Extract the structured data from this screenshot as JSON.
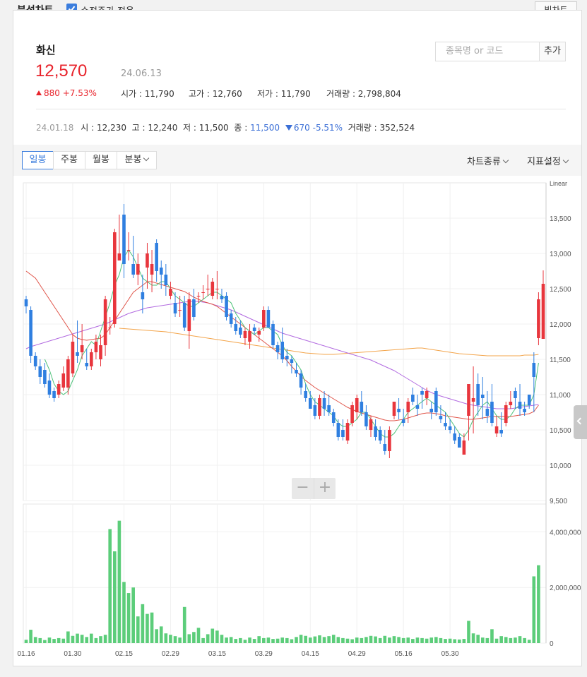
{
  "header": {
    "title": "분석차트",
    "adjusted_label": "수정주가 적용",
    "adjusted_checked": true,
    "big_chart_label": "빅차트"
  },
  "stock": {
    "name": "화신",
    "price": "12,570",
    "date": "24.06.13",
    "change": "880 +7.53%",
    "open_label": "시가",
    "open": "11,790",
    "high_label": "고가",
    "high": "12,760",
    "low_label": "저가",
    "low": "11,790",
    "volume_label": "거래량",
    "volume": "2,798,804"
  },
  "search": {
    "placeholder": "종목명 or 코드",
    "add_label": "추가"
  },
  "hover": {
    "date": "24.01.18",
    "open_label": "시",
    "open": "12,230",
    "high_label": "고",
    "high": "12,240",
    "low_label": "저",
    "low": "11,500",
    "close_label": "종",
    "close": "11,500",
    "change": "670 -5.51%",
    "volume_label": "거래량",
    "volume": "352,524"
  },
  "toolbar": {
    "tabs": [
      "일봉",
      "주봉",
      "월봉",
      "분봉"
    ],
    "active_tab": "일봉",
    "chart_type_label": "차트종류",
    "indicator_label": "지표설정"
  },
  "colors": {
    "up": "#e8363d",
    "down": "#2f7fe0",
    "volume": "#5ccd7a",
    "ma5": "#4ec27a",
    "ma20": "#e0554a",
    "ma60": "#b26be0",
    "ma120": "#f3a44a"
  },
  "chart_data": {
    "type": "candlestick",
    "scale_label": "Linear",
    "price_ticks": [
      "13,500",
      "13,000",
      "12,500",
      "12,000",
      "11,500",
      "11,000",
      "10,500",
      "10,000",
      "9,500"
    ],
    "price_tick_values": [
      13500,
      13000,
      12500,
      12000,
      11500,
      11000,
      10500,
      10000,
      9500
    ],
    "price_range": [
      9500,
      14000
    ],
    "volume_ticks": [
      "4,000,000",
      "2,000,000",
      "0"
    ],
    "volume_tick_values": [
      4000000,
      2000000,
      0
    ],
    "volume_range": [
      0,
      5000000
    ],
    "date_labels": [
      "01.16",
      "01.30",
      "02.15",
      "02.29",
      "03.15",
      "03.29",
      "04.15",
      "04.29",
      "05.16",
      "05.30"
    ],
    "date_label_index": [
      0,
      10,
      21,
      31,
      41,
      51,
      61,
      71,
      81,
      91
    ],
    "candles": [
      [
        12350,
        12400,
        12150,
        12250
      ],
      [
        12200,
        12250,
        11450,
        11550
      ],
      [
        11550,
        11600,
        11350,
        11400
      ],
      [
        11400,
        11500,
        11150,
        11250
      ],
      [
        11350,
        11450,
        11100,
        11150
      ],
      [
        11200,
        11300,
        10950,
        11000
      ],
      [
        11050,
        11100,
        10900,
        10950
      ],
      [
        11000,
        11200,
        10950,
        11150
      ],
      [
        11100,
        11400,
        11050,
        11300
      ],
      [
        11100,
        11550,
        11000,
        11500
      ],
      [
        11300,
        11850,
        11250,
        11750
      ],
      [
        11600,
        12050,
        11450,
        11550
      ],
      [
        11600,
        12000,
        11500,
        11700
      ],
      [
        11450,
        11650,
        11350,
        11400
      ],
      [
        11400,
        11650,
        11350,
        11600
      ],
      [
        11600,
        11850,
        11500,
        11750
      ],
      [
        11500,
        11850,
        11400,
        11700
      ],
      [
        11700,
        12400,
        11550,
        12350
      ],
      [
        11950,
        12100,
        11850,
        11950
      ],
      [
        12000,
        13350,
        11950,
        13300
      ],
      [
        12900,
        13550,
        12900,
        13000
      ],
      [
        13550,
        13700,
        12650,
        12850
      ],
      [
        13050,
        13300,
        12900,
        13050
      ],
      [
        12850,
        13250,
        12650,
        12700
      ],
      [
        12700,
        13000,
        12550,
        12850
      ],
      [
        12450,
        12700,
        12150,
        12350
      ],
      [
        12800,
        13150,
        12500,
        13000
      ],
      [
        12700,
        13050,
        12450,
        12850
      ],
      [
        13150,
        13200,
        12600,
        12750
      ],
      [
        12800,
        12900,
        12500,
        12700
      ],
      [
        12700,
        12850,
        12400,
        12550
      ],
      [
        12400,
        12600,
        12350,
        12500
      ],
      [
        12300,
        12450,
        12100,
        12150
      ],
      [
        12200,
        12400,
        12100,
        12200
      ],
      [
        12300,
        12400,
        11900,
        11950
      ],
      [
        11900,
        12450,
        11650,
        12350
      ],
      [
        12350,
        12500,
        12050,
        12100
      ],
      [
        12400,
        12450,
        12300,
        12400
      ],
      [
        12450,
        12550,
        12350,
        12450
      ],
      [
        12500,
        12700,
        12400,
        12500
      ],
      [
        12400,
        12650,
        12350,
        12600
      ],
      [
        12500,
        12750,
        12350,
        12500
      ],
      [
        12400,
        12500,
        12300,
        12350
      ],
      [
        12400,
        12450,
        12050,
        12100
      ],
      [
        12150,
        12200,
        11950,
        12000
      ],
      [
        12000,
        12100,
        11850,
        11900
      ],
      [
        11950,
        12050,
        11800,
        11850
      ],
      [
        11800,
        11950,
        11700,
        11900
      ],
      [
        11750,
        12000,
        11650,
        11900
      ],
      [
        11950,
        12000,
        11850,
        11900
      ],
      [
        11850,
        11950,
        11750,
        11900
      ],
      [
        11950,
        12250,
        11900,
        12200
      ],
      [
        12200,
        12250,
        11950,
        11950
      ],
      [
        12000,
        12050,
        11650,
        11700
      ],
      [
        11700,
        11750,
        11500,
        11600
      ],
      [
        11750,
        11950,
        11450,
        11500
      ],
      [
        11550,
        11650,
        11400,
        11500
      ],
      [
        11500,
        11550,
        11300,
        11450
      ],
      [
        11350,
        11450,
        11250,
        11300
      ],
      [
        11300,
        11350,
        11000,
        11100
      ],
      [
        11050,
        11150,
        10900,
        10950
      ],
      [
        10950,
        11050,
        10800,
        10800
      ],
      [
        10850,
        10950,
        10650,
        10700
      ],
      [
        10700,
        11000,
        10650,
        10950
      ],
      [
        10950,
        11050,
        10700,
        10800
      ],
      [
        10850,
        11000,
        10700,
        10750
      ],
      [
        10750,
        10800,
        10550,
        10600
      ],
      [
        10600,
        10650,
        10350,
        10400
      ],
      [
        10500,
        10650,
        10350,
        10400
      ],
      [
        10350,
        10650,
        10300,
        10600
      ],
      [
        10600,
        10900,
        10550,
        10850
      ],
      [
        10750,
        11000,
        10650,
        10950
      ],
      [
        10900,
        11050,
        10700,
        10750
      ],
      [
        10750,
        10850,
        10500,
        10550
      ],
      [
        10500,
        10700,
        10400,
        10650
      ],
      [
        10550,
        10650,
        10350,
        10400
      ],
      [
        10500,
        10550,
        10300,
        10350
      ],
      [
        10300,
        10500,
        10150,
        10200
      ],
      [
        10200,
        10550,
        10100,
        10500
      ],
      [
        10700,
        10900,
        10650,
        10900
      ],
      [
        10800,
        10950,
        10650,
        10750
      ],
      [
        10650,
        10800,
        10550,
        10600
      ],
      [
        10750,
        10950,
        10600,
        10900
      ],
      [
        11000,
        11100,
        10850,
        10900
      ],
      [
        10850,
        11000,
        10700,
        10800
      ],
      [
        11050,
        11100,
        10800,
        11000
      ],
      [
        10950,
        11100,
        10850,
        11050
      ],
      [
        10800,
        10900,
        10650,
        10750
      ],
      [
        11050,
        11100,
        10700,
        10750
      ],
      [
        10700,
        10850,
        10600,
        10650
      ],
      [
        10600,
        10750,
        10500,
        10550
      ],
      [
        10550,
        10650,
        10450,
        10500
      ],
      [
        10450,
        10550,
        10300,
        10350
      ],
      [
        10400,
        10450,
        10250,
        10250
      ],
      [
        10150,
        10450,
        10150,
        10350
      ],
      [
        10700,
        11150,
        10350,
        11150
      ],
      [
        10900,
        11400,
        10450,
        10950
      ],
      [
        11150,
        11300,
        10700,
        10850
      ],
      [
        11000,
        11250,
        10650,
        10950
      ],
      [
        10800,
        11050,
        10600,
        10700
      ],
      [
        10900,
        11150,
        10550,
        10600
      ],
      [
        10450,
        10700,
        10400,
        10550
      ],
      [
        10500,
        10750,
        10400,
        10450
      ],
      [
        10600,
        10900,
        10550,
        10850
      ],
      [
        10850,
        11050,
        10800,
        10900
      ],
      [
        11050,
        11100,
        10800,
        10950
      ],
      [
        10900,
        11150,
        10700,
        10800
      ],
      [
        10800,
        10900,
        10700,
        10750
      ],
      [
        11000,
        11000,
        10800,
        10850
      ],
      [
        11450,
        11600,
        10750,
        11250
      ],
      [
        11800,
        12450,
        11700,
        12350
      ],
      [
        11790,
        12760,
        11790,
        12570
      ]
    ],
    "volumes": [
      120000,
      480000,
      220000,
      180000,
      110000,
      200000,
      150000,
      180000,
      160000,
      420000,
      260000,
      340000,
      300000,
      220000,
      340000,
      180000,
      250000,
      300000,
      4100000,
      3300000,
      4400000,
      2200000,
      1800000,
      2000000,
      960000,
      1400000,
      1050000,
      1100000,
      500000,
      600000,
      350000,
      300000,
      250000,
      200000,
      1300000,
      320000,
      400000,
      550000,
      180000,
      320000,
      520000,
      450000,
      300000,
      200000,
      220000,
      150000,
      180000,
      120000,
      200000,
      150000,
      250000,
      180000,
      200000,
      150000,
      160000,
      200000,
      180000,
      140000,
      220000,
      300000,
      260000,
      200000,
      240000,
      280000,
      220000,
      250000,
      300000,
      220000,
      180000,
      160000,
      140000,
      200000,
      180000,
      220000,
      260000,
      240000,
      180000,
      260000,
      200000,
      250000,
      220000,
      180000,
      200000,
      150000,
      200000,
      180000,
      160000,
      200000,
      220000,
      180000,
      150000,
      160000,
      140000,
      130000,
      150000,
      800000,
      350000,
      300000,
      200000,
      180000,
      500000,
      160000,
      250000,
      220000,
      180000,
      200000,
      250000,
      180000,
      120000,
      2400000,
      2800000
    ],
    "ma5": [
      null,
      null,
      null,
      null,
      11500,
      11350,
      11150,
      11050,
      11000,
      11050,
      11200,
      11350,
      11550,
      11650,
      11750,
      11700,
      11900,
      12100,
      12300,
      12550,
      12700,
      12950,
      13050,
      12950,
      12800,
      12650,
      12600,
      12550,
      12550,
      12600,
      12600,
      12500,
      12400,
      12350,
      12300,
      12250,
      12250,
      12300,
      12350,
      12400,
      12450,
      12450,
      12400,
      12350,
      12300,
      12150,
      12050,
      11950,
      11900,
      11850,
      11900,
      11950,
      11950,
      11900,
      11850,
      11700,
      11600,
      11550,
      11450,
      11350,
      11150,
      11000,
      10900,
      10850,
      10800,
      10750,
      10700,
      10600,
      10550,
      10550,
      10600,
      10650,
      10750,
      10750,
      10650,
      10550,
      10450,
      10400,
      10400,
      10450,
      10550,
      10650,
      10750,
      10800,
      10850,
      10900,
      10950,
      10900,
      10850,
      10800,
      10750,
      10650,
      10550,
      10450,
      10400,
      10500,
      10650,
      10750,
      10850,
      10900,
      10800,
      10700,
      10650,
      10650,
      10700,
      10800,
      10850,
      10850,
      10850,
      11000,
      11450
    ],
    "ma20": [
      12750,
      12700,
      12650,
      12550,
      12450,
      12350,
      12250,
      12150,
      12050,
      11950,
      11850,
      11800,
      11780,
      11770,
      11780,
      11790,
      11800,
      11850,
      11950,
      12050,
      12150,
      12250,
      12350,
      12450,
      12500,
      12550,
      12600,
      12600,
      12580,
      12560,
      12540,
      12520,
      12500,
      12480,
      12460,
      12420,
      12380,
      12350,
      12320,
      12300,
      12280,
      12250,
      12200,
      12150,
      12100,
      12050,
      12000,
      11950,
      11900,
      11850,
      11800,
      11750,
      11700,
      11650,
      11600,
      11550,
      11480,
      11400,
      11330,
      11260,
      11200,
      11150,
      11100,
      11060,
      11020,
      10980,
      10940,
      10900,
      10860,
      10820,
      10790,
      10760,
      10740,
      10720,
      10700,
      10680,
      10660,
      10640,
      10630,
      10630,
      10640,
      10650,
      10670,
      10690,
      10710,
      10730,
      10740,
      10740,
      10730,
      10720,
      10700,
      10690,
      10680,
      10670,
      10660,
      10650,
      10650,
      10660,
      10670,
      10680,
      10690,
      10690,
      10690,
      10690,
      10690,
      10700,
      10710,
      10720,
      10730,
      10760,
      10850
    ],
    "ma60": [
      11650,
      11680,
      11700,
      11720,
      11740,
      11760,
      11780,
      11800,
      11820,
      11840,
      11860,
      11880,
      11900,
      11920,
      11940,
      11960,
      11980,
      12000,
      12030,
      12060,
      12090,
      12120,
      12150,
      12170,
      12190,
      12210,
      12230,
      12240,
      12250,
      12260,
      12270,
      12280,
      12290,
      12300,
      12310,
      12320,
      12320,
      12320,
      12310,
      12300,
      12280,
      12260,
      12240,
      12220,
      12200,
      12170,
      12140,
      12110,
      12080,
      12050,
      12020,
      11990,
      11960,
      11930,
      11900,
      11870,
      11850,
      11830,
      11810,
      11790,
      11770,
      11750,
      11730,
      11710,
      11690,
      11670,
      11650,
      11630,
      11610,
      11590,
      11570,
      11550,
      11530,
      11510,
      11490,
      11460,
      11430,
      11400,
      11370,
      11340,
      11300,
      11260,
      11220,
      11180,
      11140,
      11100,
      11060,
      11030,
      11000,
      10980,
      10960,
      10940,
      10920,
      10900,
      10880,
      10860,
      10850,
      10840,
      10830,
      10820,
      10810,
      10800,
      10800,
      10800,
      10800,
      10810,
      10820,
      10830,
      10840,
      10850,
      10860
    ],
    "ma120": [
      null,
      null,
      null,
      null,
      null,
      null,
      null,
      null,
      null,
      null,
      null,
      null,
      null,
      null,
      null,
      null,
      null,
      null,
      null,
      null,
      11940,
      11935,
      11930,
      11925,
      11920,
      11915,
      11910,
      11905,
      11900,
      11895,
      11890,
      11880,
      11870,
      11860,
      11850,
      11840,
      11830,
      11820,
      11810,
      11800,
      11790,
      11780,
      11770,
      11760,
      11750,
      11740,
      11730,
      11720,
      11710,
      11700,
      11690,
      11680,
      11670,
      11660,
      11650,
      11640,
      11630,
      11620,
      11610,
      11600,
      11590,
      11585,
      11580,
      11575,
      11570,
      11570,
      11570,
      11575,
      11580,
      11585,
      11590,
      11595,
      11600,
      11605,
      11610,
      11615,
      11620,
      11625,
      11630,
      11635,
      11640,
      11645,
      11650,
      11655,
      11660,
      11660,
      11650,
      11640,
      11630,
      11620,
      11610,
      11600,
      11590,
      11580,
      11575,
      11570,
      11565,
      11560,
      11555,
      11550,
      11550,
      11550,
      11550,
      11550,
      11550,
      11550,
      11550,
      11560,
      11560,
      11560,
      11570
    ]
  }
}
